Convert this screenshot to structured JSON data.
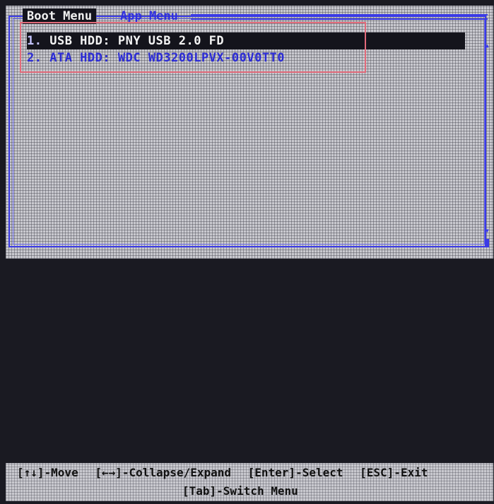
{
  "tabs": {
    "boot_menu": "Boot Menu",
    "app_menu": "App Menu"
  },
  "boot_items": [
    {
      "number": "1.",
      "label": "USB HDD: PNY USB 2.0 FD"
    },
    {
      "number": "2.",
      "label": "ATA HDD: WDC WD3200LPVX-00V0TT0"
    }
  ],
  "scroll": {
    "up_icon": "▴",
    "down_icon": "▾"
  },
  "help": {
    "move": "[↑↓]-Move",
    "collapse_expand": "[←→]-Collapse/Expand",
    "select": "[Enter]-Select",
    "exit": "[ESC]-Exit",
    "switch_menu": "[Tab]-Switch Menu"
  },
  "colors": {
    "accent_blue": "#3a3ae6",
    "panel_grey": "#c9c9cf",
    "highlight_red": "#e26a7a",
    "background_dark": "#1a1a22"
  }
}
